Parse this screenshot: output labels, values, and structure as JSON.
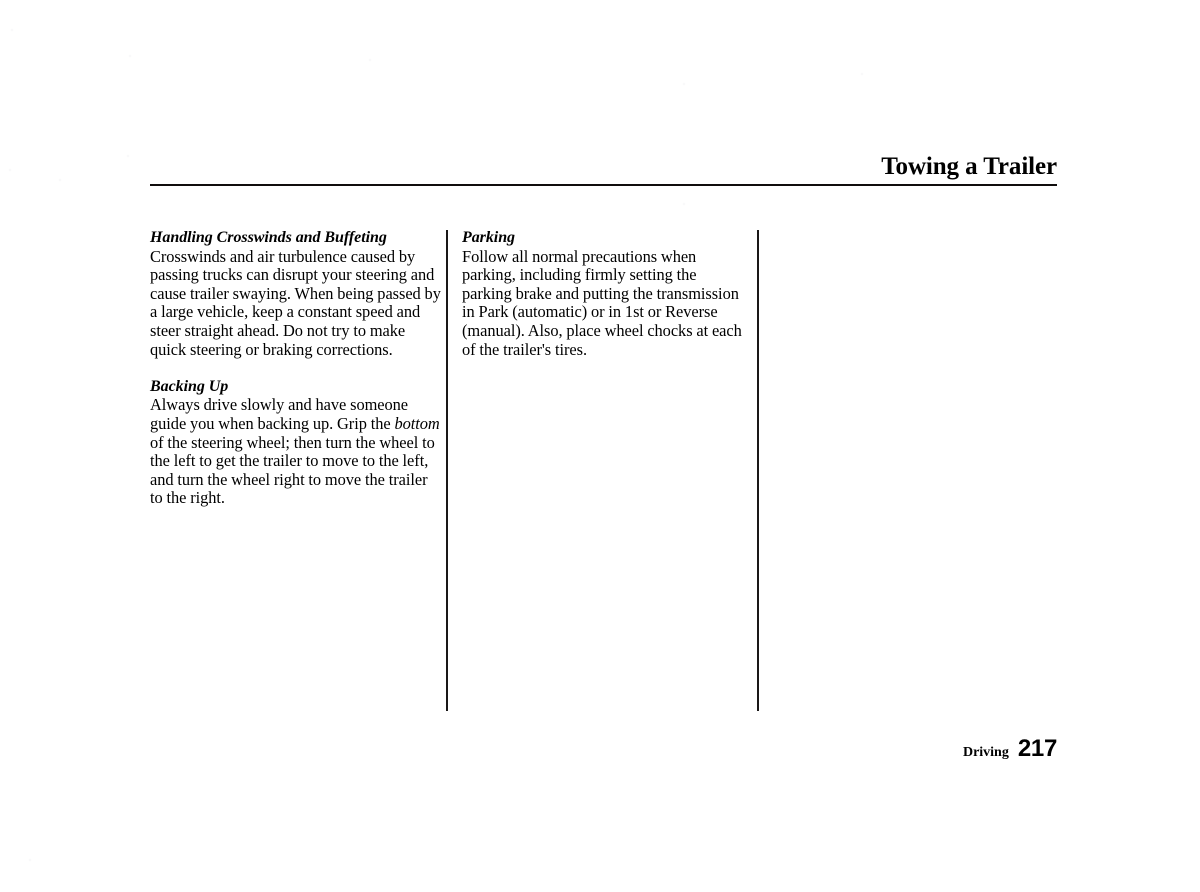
{
  "page": {
    "running_head": "Towing a Trailer",
    "background_color": "#ffffff",
    "text_color": "#000000",
    "rule_color": "#100d0d"
  },
  "columns": {
    "one": [
      {
        "heading": "Handling Crosswinds and Buffeting",
        "body_before_emphasis": "Crosswinds and air turbulence caused by passing trucks can disrupt your steering and cause trailer swaying. When being passed by a large vehicle, keep a constant speed and steer straight ahead. Do not try to make quick steering or braking corrections.",
        "emphasis": "",
        "body_after_emphasis": ""
      },
      {
        "heading": "Backing Up",
        "body_before_emphasis": "Always drive slowly and have someone guide you when backing up. Grip the ",
        "emphasis": "bottom",
        "body_after_emphasis": " of the steering wheel; then turn the wheel to the left to get the trailer to move to the left, and turn the wheel right to move the trailer to the right."
      }
    ],
    "two": [
      {
        "heading": "Parking",
        "body_before_emphasis": "Follow all normal precautions when parking, including firmly setting the parking brake and putting the transmission in Park (automatic) or in 1st or Reverse (manual). Also, place wheel chocks at each of the trailer's tires.",
        "emphasis": "",
        "body_after_emphasis": ""
      }
    ],
    "three": []
  },
  "footer": {
    "chapter": "Driving",
    "page_number": "217"
  }
}
